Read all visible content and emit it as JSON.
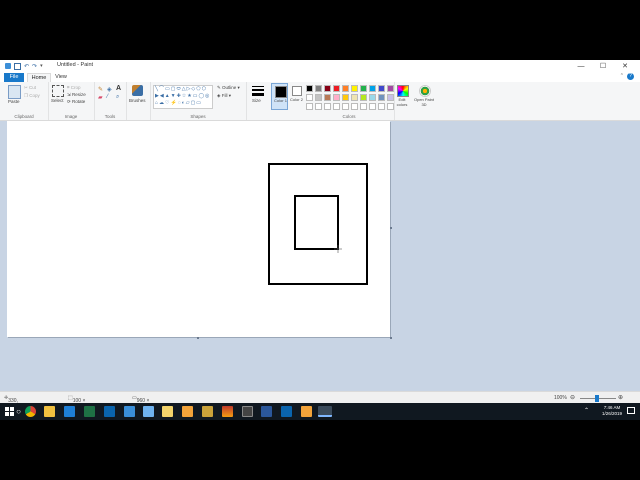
{
  "window": {
    "title": "Untitled - Paint",
    "min_symbol": "—",
    "max_symbol": "☐",
    "close_symbol": "✕"
  },
  "tabs": {
    "file": "File",
    "home": "Home",
    "view": "View"
  },
  "ribbon": {
    "clipboard": {
      "paste": "Paste",
      "cut": "Cut",
      "copy": "Copy",
      "label": "Clipboard"
    },
    "image": {
      "select": "Select",
      "crop": "Crop",
      "resize": "Resize",
      "rotate": "Rotate",
      "label": "Image"
    },
    "tools": {
      "label": "Tools",
      "text_glyph": "A"
    },
    "brushes": {
      "label": "Brushes"
    },
    "shapes": {
      "outline": "Outline",
      "fill": "Fill",
      "label": "Shapes"
    },
    "size": {
      "label": "Size"
    },
    "color1": {
      "label": "Color 1"
    },
    "color2": {
      "label": "Color 2"
    },
    "colors": {
      "label": "Colors",
      "row1": [
        "#000000",
        "#7f7f7f",
        "#880015",
        "#ed1c24",
        "#ff7f27",
        "#fff200",
        "#22b14c",
        "#00a2e8",
        "#3f48cc",
        "#a349a4"
      ],
      "row2": [
        "#ffffff",
        "#c3c3c3",
        "#b97a57",
        "#ffaec9",
        "#ffc90e",
        "#efe4b0",
        "#b5e61d",
        "#99d9ea",
        "#7092be",
        "#c8bfe7"
      ],
      "row3": [
        "#ffffff",
        "#ffffff",
        "#ffffff",
        "#ffffff",
        "#ffffff",
        "#ffffff",
        "#ffffff",
        "#ffffff",
        "#ffffff",
        "#ffffff"
      ]
    },
    "edit_colors": "Edit colors",
    "paint3d": "Open Paint 3D"
  },
  "status": {
    "cursor": "330, 321px",
    "selection": "100 × 134px",
    "canvas_size": "960 × 540px",
    "zoom": "100%"
  },
  "taskbar": {
    "time": "7:46 AM",
    "date": "1/26/2019"
  }
}
